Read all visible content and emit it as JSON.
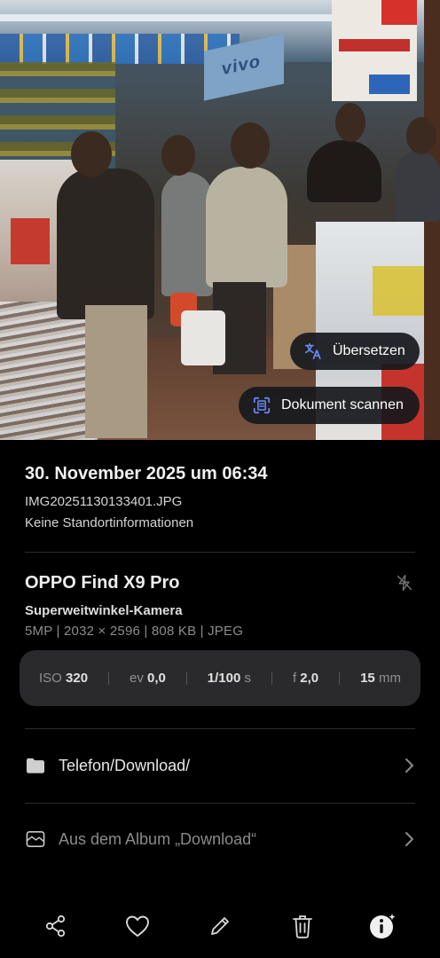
{
  "overlay": {
    "translate_label": "Übersetzen",
    "scan_label": "Dokument scannen"
  },
  "photo_sign": "vivo",
  "info": {
    "date": "30. November 2025 um 06:34",
    "filename": "IMG20251130133401.JPG",
    "location": "Keine Standortinformationen"
  },
  "device": {
    "name": "OPPO Find X9 Pro",
    "camera": "Superweitwinkel-Kamera",
    "specs": "5MP  |  2032 × 2596  |  808 KB  |  JPEG",
    "flash_icon": "flash-off-icon"
  },
  "exif": {
    "iso_label": "ISO",
    "iso_value": "320",
    "ev_label": "ev",
    "ev_value": "0,0",
    "shutter_value": "1/100",
    "shutter_unit": "s",
    "aperture_label": "f",
    "aperture_value": "2,0",
    "focal_value": "15",
    "focal_unit": "mm"
  },
  "rows": {
    "folder_label": "Telefon/Download/",
    "album_label": "Aus dem Album „Download“"
  },
  "toolbar": {
    "icons": [
      "share-icon",
      "heart-icon",
      "edit-icon",
      "delete-icon",
      "info-icon"
    ]
  },
  "colors": {
    "background": "#000000",
    "exif_panel": "#2a2a2c",
    "chip_bg": "#16181c",
    "accent_icon": "#6d8cff"
  }
}
